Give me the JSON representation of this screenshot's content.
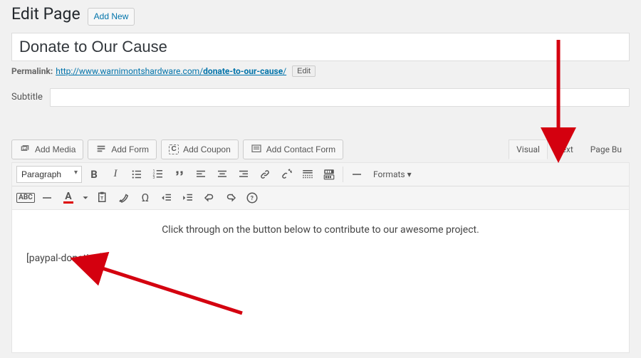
{
  "heading": "Edit Page",
  "add_new": "Add New",
  "title": "Donate to Our Cause",
  "permalink": {
    "label": "Permalink:",
    "base": "http://www.warnimontshardware.com/",
    "slug": "donate-to-our-cause",
    "trail": "/",
    "edit": "Edit"
  },
  "subtitle": {
    "label": "Subtitle",
    "value": ""
  },
  "media": {
    "add_media": "Add Media",
    "add_form": "Add Form",
    "add_coupon": "Add Coupon",
    "add_contact": "Add Contact Form"
  },
  "tabs": {
    "visual": "Visual",
    "text": "Text",
    "page_builder": "Page Bu"
  },
  "toolbar": {
    "paragraph": "Paragraph",
    "formats": "Formats ▾"
  },
  "content": {
    "line1": "Click through on the button below to contribute to our awesome project.",
    "line2": "[paypal-donation]"
  }
}
